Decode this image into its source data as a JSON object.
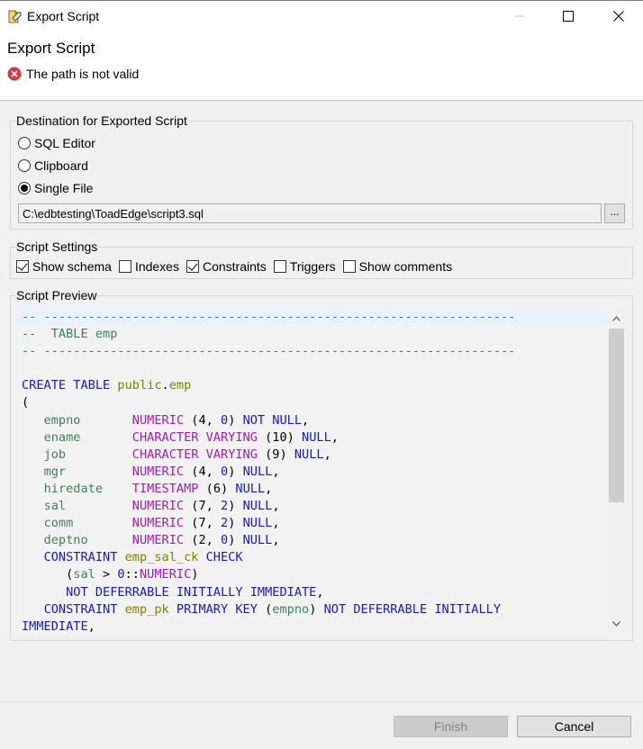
{
  "window": {
    "title": "Export Script",
    "icons": {
      "app": "export-script-icon",
      "minimize": "minimize-icon",
      "maximize": "maximize-icon",
      "close": "close-icon"
    }
  },
  "header": {
    "title": "Export Script",
    "error_message": "The path is not valid",
    "error_icon": "error-icon",
    "error_color": "#d9363e"
  },
  "destination": {
    "label": "Destination for Exported Script",
    "options": [
      {
        "label": "SQL Editor",
        "selected": false
      },
      {
        "label": "Clipboard",
        "selected": false
      },
      {
        "label": "Single File",
        "selected": true
      }
    ],
    "file_path": "C:\\edbtesting\\ToadEdge\\script3.sql",
    "browse_label": "..."
  },
  "settings": {
    "label": "Script Settings",
    "checkboxes": [
      {
        "label": "Show schema",
        "checked": true
      },
      {
        "label": "Indexes",
        "checked": false
      },
      {
        "label": "Constraints",
        "checked": true
      },
      {
        "label": "Triggers",
        "checked": false
      },
      {
        "label": "Show comments",
        "checked": false
      }
    ]
  },
  "preview": {
    "label": "Script Preview",
    "lines": [
      [
        [
          "c-comment",
          "-- ----------------------------------------------------------------"
        ]
      ],
      [
        [
          "c-comment",
          "--  TABLE emp"
        ]
      ],
      [
        [
          "c-comment",
          "-- ----------------------------------------------------------------"
        ]
      ],
      [
        [
          "c-plain",
          ""
        ]
      ],
      [
        [
          "c-kw",
          "CREATE TABLE "
        ],
        [
          "c-id",
          "public"
        ],
        [
          "c-plain",
          "."
        ],
        [
          "c-id",
          "emp"
        ]
      ],
      [
        [
          "c-plain",
          "("
        ]
      ],
      [
        [
          "c-plain",
          "   "
        ],
        [
          "c-col",
          "empno"
        ],
        [
          "c-plain",
          "       "
        ],
        [
          "c-type",
          "NUMERIC"
        ],
        [
          "c-plain",
          " (4, "
        ],
        [
          "c-num",
          "0"
        ],
        [
          "c-plain",
          ") "
        ],
        [
          "c-null",
          "NOT NULL"
        ],
        [
          "c-plain",
          ","
        ]
      ],
      [
        [
          "c-plain",
          "   "
        ],
        [
          "c-col",
          "ename"
        ],
        [
          "c-plain",
          "       "
        ],
        [
          "c-type",
          "CHARACTER VARYING"
        ],
        [
          "c-plain",
          " (10) "
        ],
        [
          "c-null",
          "NULL"
        ],
        [
          "c-plain",
          ","
        ]
      ],
      [
        [
          "c-plain",
          "   "
        ],
        [
          "c-col",
          "job"
        ],
        [
          "c-plain",
          "         "
        ],
        [
          "c-type",
          "CHARACTER VARYING"
        ],
        [
          "c-plain",
          " (9) "
        ],
        [
          "c-null",
          "NULL"
        ],
        [
          "c-plain",
          ","
        ]
      ],
      [
        [
          "c-plain",
          "   "
        ],
        [
          "c-col",
          "mgr"
        ],
        [
          "c-plain",
          "         "
        ],
        [
          "c-type",
          "NUMERIC"
        ],
        [
          "c-plain",
          " (4, "
        ],
        [
          "c-num",
          "0"
        ],
        [
          "c-plain",
          ") "
        ],
        [
          "c-null",
          "NULL"
        ],
        [
          "c-plain",
          ","
        ]
      ],
      [
        [
          "c-plain",
          "   "
        ],
        [
          "c-col",
          "hiredate"
        ],
        [
          "c-plain",
          "    "
        ],
        [
          "c-type",
          "TIMESTAMP"
        ],
        [
          "c-plain",
          " (6) "
        ],
        [
          "c-null",
          "NULL"
        ],
        [
          "c-plain",
          ","
        ]
      ],
      [
        [
          "c-plain",
          "   "
        ],
        [
          "c-col",
          "sal"
        ],
        [
          "c-plain",
          "         "
        ],
        [
          "c-type",
          "NUMERIC"
        ],
        [
          "c-plain",
          " (7, "
        ],
        [
          "c-num",
          "2"
        ],
        [
          "c-plain",
          ") "
        ],
        [
          "c-null",
          "NULL"
        ],
        [
          "c-plain",
          ","
        ]
      ],
      [
        [
          "c-plain",
          "   "
        ],
        [
          "c-col",
          "comm"
        ],
        [
          "c-plain",
          "        "
        ],
        [
          "c-type",
          "NUMERIC"
        ],
        [
          "c-plain",
          " (7, "
        ],
        [
          "c-num",
          "2"
        ],
        [
          "c-plain",
          ") "
        ],
        [
          "c-null",
          "NULL"
        ],
        [
          "c-plain",
          ","
        ]
      ],
      [
        [
          "c-plain",
          "   "
        ],
        [
          "c-col",
          "deptno"
        ],
        [
          "c-plain",
          "      "
        ],
        [
          "c-type",
          "NUMERIC"
        ],
        [
          "c-plain",
          " (2, "
        ],
        [
          "c-num",
          "0"
        ],
        [
          "c-plain",
          ") "
        ],
        [
          "c-null",
          "NULL"
        ],
        [
          "c-plain",
          ","
        ]
      ],
      [
        [
          "c-plain",
          "   "
        ],
        [
          "c-kw",
          "CONSTRAINT "
        ],
        [
          "c-id",
          "emp_sal_ck"
        ],
        [
          "c-kw",
          " CHECK"
        ]
      ],
      [
        [
          "c-plain",
          "      ("
        ],
        [
          "c-col",
          "sal"
        ],
        [
          "c-plain",
          " > "
        ],
        [
          "c-num",
          "0"
        ],
        [
          "c-plain",
          "::"
        ],
        [
          "c-type",
          "NUMERIC"
        ],
        [
          "c-plain",
          ")"
        ]
      ],
      [
        [
          "c-plain",
          "      "
        ],
        [
          "c-kw",
          "NOT DEFERRABLE INITIALLY IMMEDIATE"
        ],
        [
          "c-plain",
          ","
        ]
      ],
      [
        [
          "c-plain",
          "   "
        ],
        [
          "c-kw",
          "CONSTRAINT "
        ],
        [
          "c-id",
          "emp_pk"
        ],
        [
          "c-kw",
          " PRIMARY KEY "
        ],
        [
          "c-plain",
          "("
        ],
        [
          "c-col",
          "empno"
        ],
        [
          "c-plain",
          ") "
        ],
        [
          "c-kw",
          "NOT DEFERRABLE INITIALLY"
        ]
      ],
      [
        [
          "c-kw",
          "IMMEDIATE"
        ],
        [
          "c-plain",
          ","
        ]
      ]
    ]
  },
  "footer": {
    "finish_label": "Finish",
    "finish_enabled": false,
    "cancel_label": "Cancel"
  }
}
